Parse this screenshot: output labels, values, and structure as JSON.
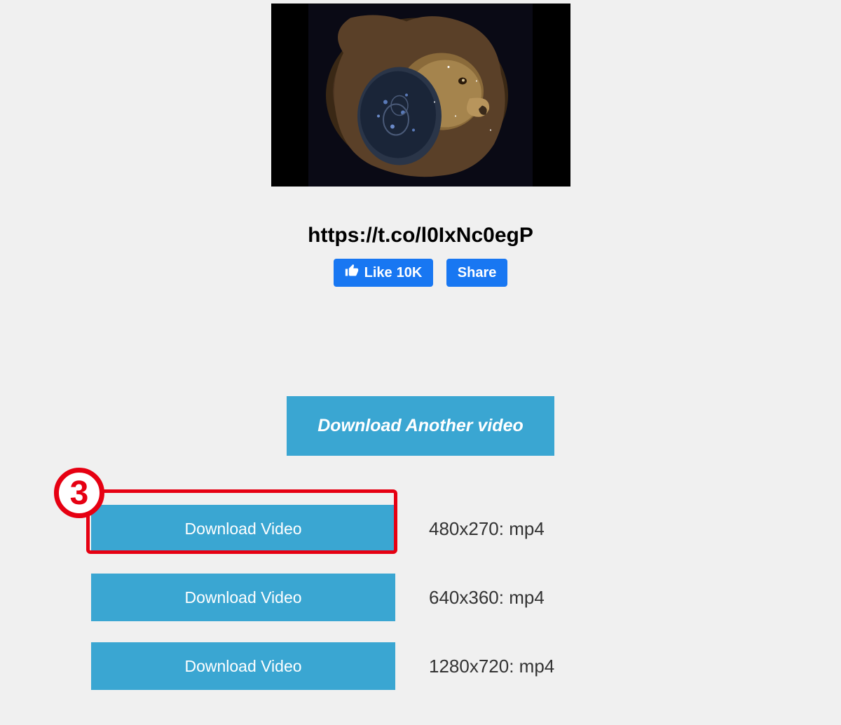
{
  "video_url": "https://t.co/l0IxNc0egP",
  "social": {
    "like_label": "Like",
    "like_count": "10K",
    "share_label": "Share"
  },
  "download_another_label": "Download Another video",
  "step_number": "3",
  "downloads": [
    {
      "button_label": "Download Video",
      "format_label": "480x270: mp4"
    },
    {
      "button_label": "Download Video",
      "format_label": "640x360: mp4"
    },
    {
      "button_label": "Download Video",
      "format_label": "1280x720: mp4"
    }
  ]
}
